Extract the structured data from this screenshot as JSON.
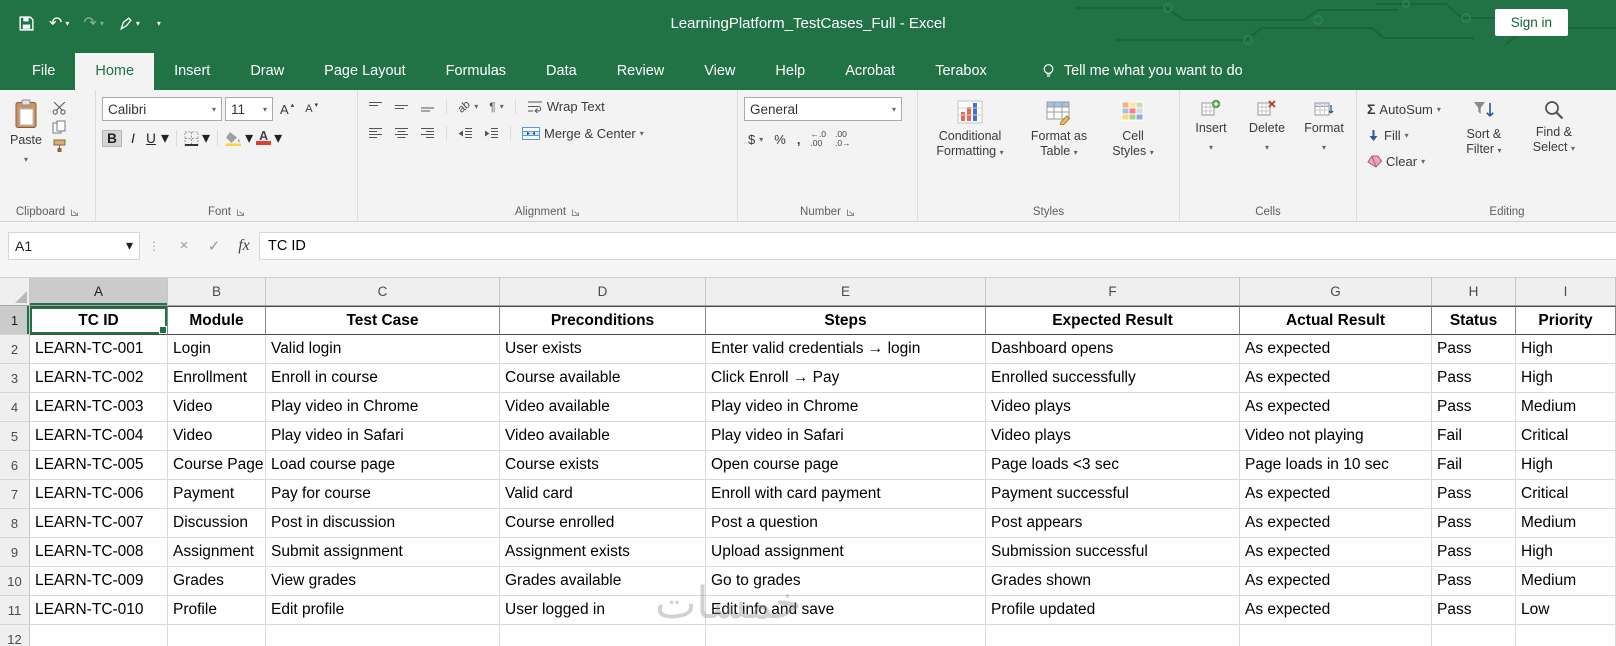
{
  "title_bar": {
    "title": "LearningPlatform_TestCases_Full  -  Excel",
    "sign_in": "Sign in"
  },
  "tabs": [
    "File",
    "Home",
    "Insert",
    "Draw",
    "Page Layout",
    "Formulas",
    "Data",
    "Review",
    "View",
    "Help",
    "Acrobat",
    "Terabox"
  ],
  "tell_me": "Tell me what you want to do",
  "icons": {
    "caret": "▾",
    "undo": "↶",
    "redo": "↷",
    "sigma": "Σ",
    "bold": "B",
    "italic": "I",
    "underline": "U",
    "dollar": "$",
    "percent": "%",
    "comma": ",",
    "font_a": "A",
    "up": "▴",
    "down": "▾",
    "close": "×",
    "check": "✓",
    "orientation": "ab",
    "pilcrow": "¶",
    "dots": "⋮"
  },
  "ribbon": {
    "clipboard": {
      "label": "Clipboard",
      "paste": "Paste"
    },
    "font": {
      "label": "Font",
      "name": "Calibri",
      "size": "11"
    },
    "alignment": {
      "label": "Alignment",
      "wrap_text": "Wrap Text",
      "merge_center": "Merge & Center"
    },
    "number": {
      "label": "Number",
      "format": "General",
      "inc_top": "←.0",
      "inc_bottom": ".00",
      "dec_top": ".00",
      "dec_bottom": ".0→"
    },
    "styles": {
      "label": "Styles",
      "conditional_formatting": "Conditional Formatting",
      "format_as_table": "Format as Table",
      "cell_styles": "Cell Styles"
    },
    "cells": {
      "label": "Cells",
      "insert": "Insert",
      "delete": "Delete",
      "format": "Format"
    },
    "editing": {
      "label": "Editing",
      "autosum": "AutoSum",
      "fill": "Fill",
      "clear": "Clear",
      "sort_filter": "Sort & Filter",
      "find_select": "Find & Select"
    }
  },
  "formula_bar": {
    "name_box": "A1",
    "fx": "fx",
    "value": "TC ID"
  },
  "sheet": {
    "column_letters": [
      "A",
      "B",
      "C",
      "D",
      "E",
      "F",
      "G",
      "H",
      "I"
    ],
    "headers": [
      "TC ID",
      "Module",
      "Test Case",
      "Preconditions",
      "Steps",
      "Expected Result",
      "Actual Result",
      "Status",
      "Priority"
    ],
    "data": [
      [
        "LEARN-TC-001",
        "Login",
        "Valid login",
        "User exists",
        "Enter valid credentials → login",
        "Dashboard opens",
        "As expected",
        "Pass",
        "High"
      ],
      [
        "LEARN-TC-002",
        "Enrollment",
        "Enroll in course",
        "Course available",
        "Click Enroll → Pay",
        "Enrolled successfully",
        "As expected",
        "Pass",
        "High"
      ],
      [
        "LEARN-TC-003",
        "Video",
        "Play video in Chrome",
        "Video available",
        "Play video in Chrome",
        "Video plays",
        "As expected",
        "Pass",
        "Medium"
      ],
      [
        "LEARN-TC-004",
        "Video",
        "Play video in Safari",
        "Video available",
        "Play video in Safari",
        "Video plays",
        "Video not playing",
        "Fail",
        "Critical"
      ],
      [
        "LEARN-TC-005",
        "Course Page",
        "Load course page",
        "Course exists",
        "Open course page",
        "Page loads <3 sec",
        "Page loads in 10 sec",
        "Fail",
        "High"
      ],
      [
        "LEARN-TC-006",
        "Payment",
        "Pay for course",
        "Valid card",
        "Enroll with card payment",
        "Payment successful",
        "As expected",
        "Pass",
        "Critical"
      ],
      [
        "LEARN-TC-007",
        "Discussion",
        "Post in discussion",
        "Course enrolled",
        "Post a question",
        "Post appears",
        "As expected",
        "Pass",
        "Medium"
      ],
      [
        "LEARN-TC-008",
        "Assignment",
        "Submit assignment",
        "Assignment exists",
        "Upload assignment",
        "Submission successful",
        "As expected",
        "Pass",
        "High"
      ],
      [
        "LEARN-TC-009",
        "Grades",
        "View grades",
        "Grades available",
        "Go to grades",
        "Grades shown",
        "As expected",
        "Pass",
        "Medium"
      ],
      [
        "LEARN-TC-010",
        "Profile",
        "Edit profile",
        "User logged in",
        "Edit info and save",
        "Profile updated",
        "As expected",
        "Pass",
        "Low"
      ]
    ],
    "selected_cell": "A1",
    "watermark": "خمسات"
  }
}
